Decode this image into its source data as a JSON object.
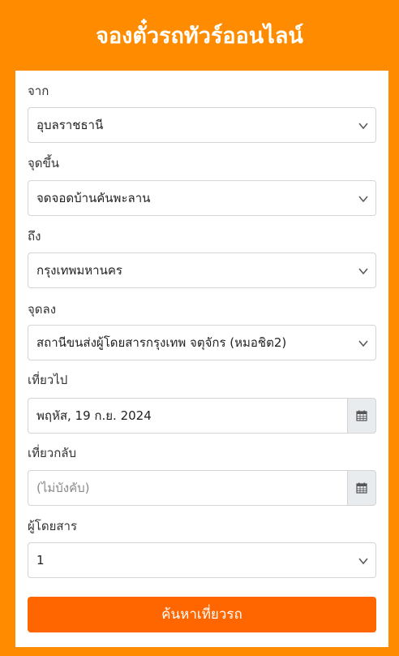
{
  "header": {
    "title": "จองตั๋วรถทัวร์ออนไลน์"
  },
  "form": {
    "from": {
      "label": "จาก",
      "value": "อุบลราชธานี"
    },
    "pickup": {
      "label": "จุดขึ้น",
      "value": "จดจอดบ้านคันพะลาน"
    },
    "to": {
      "label": "ถึง",
      "value": "กรุงเทพมหานคร"
    },
    "dropoff": {
      "label": "จุดลง",
      "value": "สถานีขนส่งผู้โดยสารกรุงเทพ จตุจักร (หมอชิต2)"
    },
    "depart": {
      "label": "เที่ยวไป",
      "value": "พฤหัส, 19 ก.ย. 2024"
    },
    "return": {
      "label": "เที่ยวกลับ",
      "placeholder": "(ไม่บังคับ)"
    },
    "passengers": {
      "label": "ผู้โดยสาร",
      "value": "1"
    },
    "search_label": "ค้นหาเที่ยวรถ"
  },
  "icons": {
    "dropdown": "chevron-down-icon",
    "calendar": "calendar-icon"
  },
  "colors": {
    "background": "#ff8c00",
    "button": "#ff6600",
    "panel": "#ffffff"
  }
}
